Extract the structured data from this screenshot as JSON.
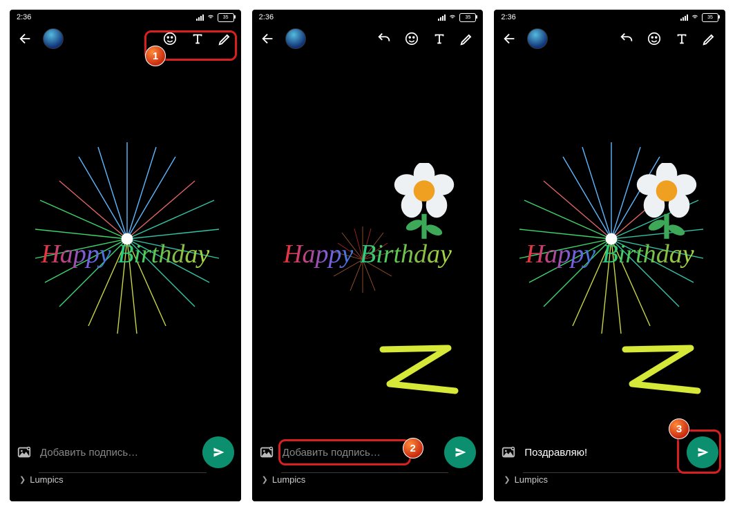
{
  "status": {
    "time": "2:36",
    "battery": "35"
  },
  "greeting": {
    "happy": "Happy",
    "birthday": "Birthday"
  },
  "screen1": {
    "caption_placeholder": "Добавить подпись…",
    "recipient": "Lumpics"
  },
  "screen2": {
    "caption_placeholder": "Добавить подпись…",
    "recipient": "Lumpics"
  },
  "screen3": {
    "caption_text": "Поздравляю!",
    "recipient": "Lumpics"
  },
  "steps": {
    "s1": "1",
    "s2": "2",
    "s3": "3"
  }
}
